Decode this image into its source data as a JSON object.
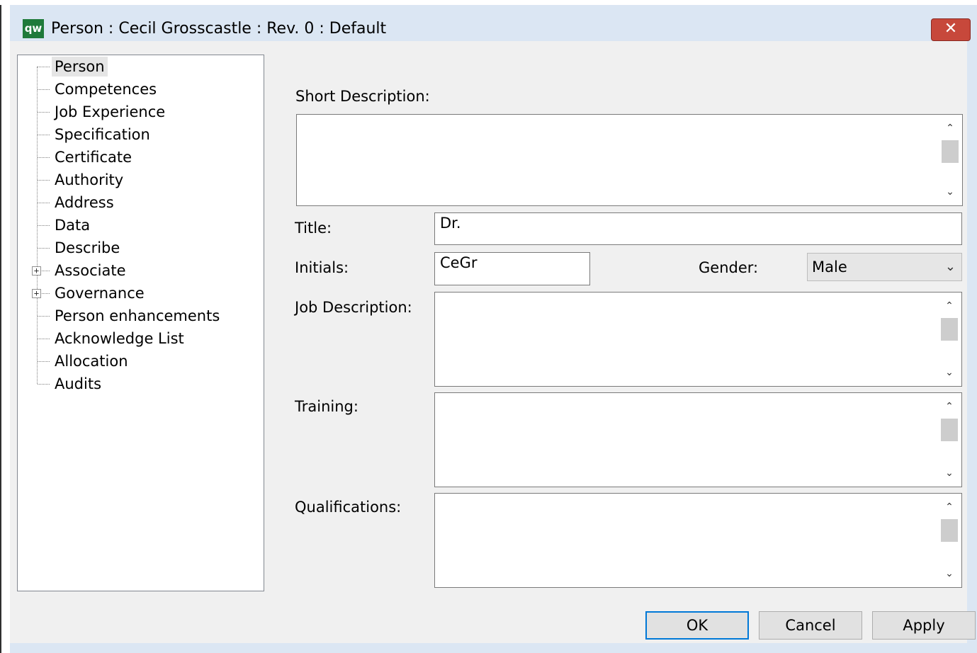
{
  "window": {
    "app_icon": "qw",
    "title": "Person : Cecil Grosscastle : Rev. 0  : Default",
    "close_glyph": "✕"
  },
  "tree": {
    "items": [
      {
        "label": "Person",
        "selected": true
      },
      {
        "label": "Competences"
      },
      {
        "label": "Job Experience"
      },
      {
        "label": "Specification"
      },
      {
        "label": "Certificate"
      },
      {
        "label": "Authority"
      },
      {
        "label": "Address"
      },
      {
        "label": "Data"
      },
      {
        "label": "Describe"
      },
      {
        "label": "Associate",
        "expandable": true
      },
      {
        "label": "Governance",
        "expandable": true
      },
      {
        "label": "Person enhancements"
      },
      {
        "label": "Acknowledge List"
      },
      {
        "label": "Allocation"
      },
      {
        "label": "Audits"
      }
    ],
    "expander_glyph": "+"
  },
  "form": {
    "short_description": {
      "label": "Short Description:",
      "value": ""
    },
    "title": {
      "label": "Title:",
      "value": "Dr."
    },
    "initials": {
      "label": "Initials:",
      "value": "CeGr"
    },
    "gender": {
      "label": "Gender:",
      "value": "Male"
    },
    "job_description": {
      "label": "Job Description:",
      "value": ""
    },
    "training": {
      "label": "Training:",
      "value": ""
    },
    "qualifications": {
      "label": "Qualifications:",
      "value": ""
    }
  },
  "icons": {
    "scroll_up": "⌃",
    "scroll_down": "⌄",
    "chevron_down": "⌄"
  },
  "buttons": {
    "ok": "OK",
    "cancel": "Cancel",
    "apply": "Apply"
  }
}
